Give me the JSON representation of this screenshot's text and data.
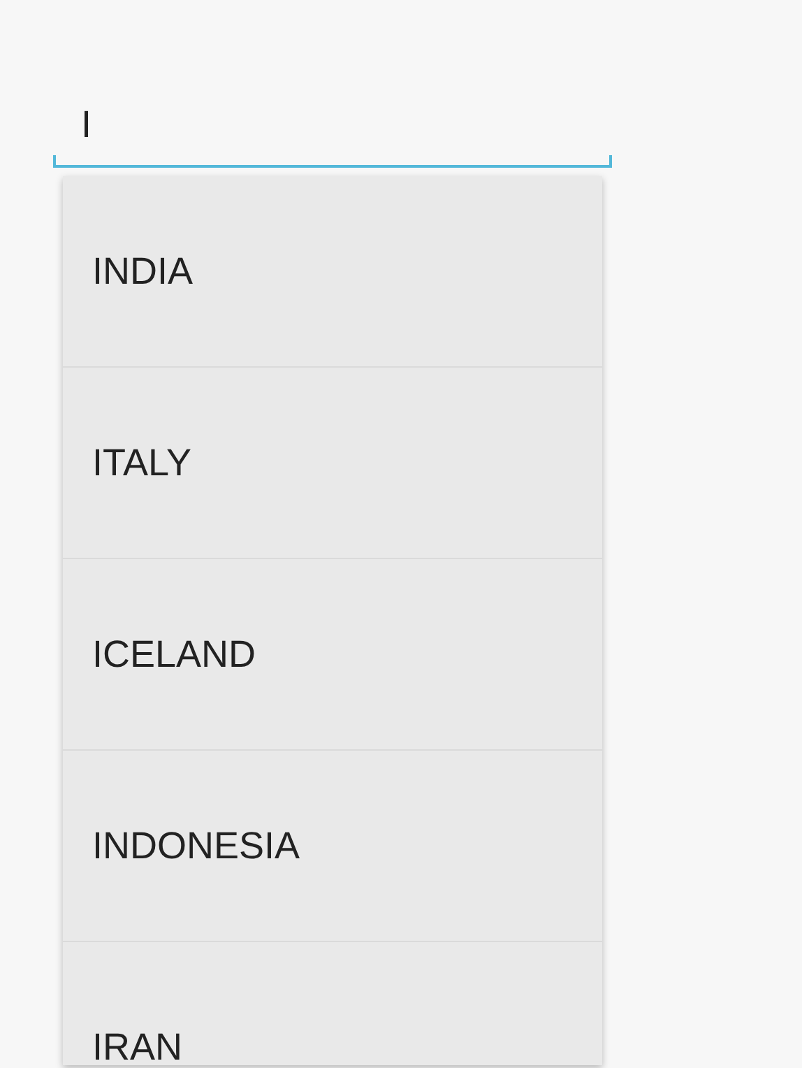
{
  "search": {
    "value": "I"
  },
  "suggestions": [
    {
      "label": "INDIA"
    },
    {
      "label": "ITALY"
    },
    {
      "label": "ICELAND"
    },
    {
      "label": "INDONESIA"
    },
    {
      "label": "IRAN"
    }
  ]
}
